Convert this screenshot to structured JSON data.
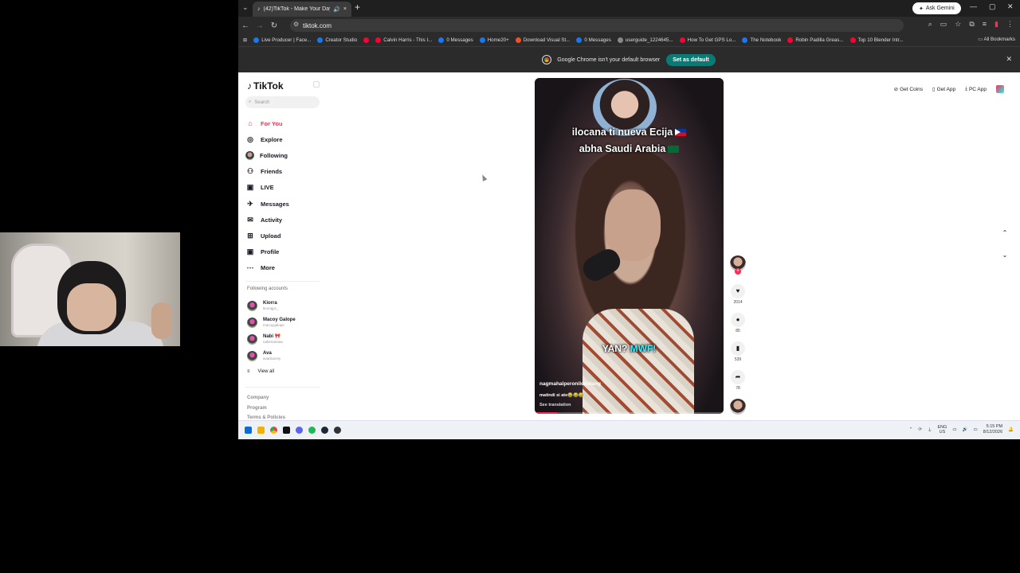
{
  "browser": {
    "tab_title": "(42)TikTok - Make Your Day",
    "tab_close": "×",
    "new_tab": "+",
    "ask_gemini": "Ask Gemini",
    "url": "tiktok.com"
  },
  "bookmarks": [
    {
      "label": "Live Producer | Face...",
      "color": "#1877f2"
    },
    {
      "label": "Creator Studio",
      "color": "#1877f2"
    },
    {
      "label": "",
      "color": "#ff0033"
    },
    {
      "label": "Calvin Harris - This I...",
      "color": "#ff0033"
    },
    {
      "label": "0 Messages",
      "color": "#1877f2"
    },
    {
      "label": "Home20+",
      "color": "#1877f2"
    },
    {
      "label": "Download Visual St...",
      "color": "#f25022"
    },
    {
      "label": "0 Messages",
      "color": "#1877f2"
    },
    {
      "label": "userguide_1224645...",
      "color": "#888888"
    },
    {
      "label": "How To Get GPS Lo...",
      "color": "#ff0033"
    },
    {
      "label": "The Notebook",
      "color": "#1877f2"
    },
    {
      "label": "Robin Padilla Greas...",
      "color": "#ff0033"
    },
    {
      "label": "Top 10 Blender Intr...",
      "color": "#ff0033"
    }
  ],
  "all_bookmarks": "All Bookmarks",
  "infobar": {
    "message": "Google Chrome isn't your default browser",
    "button": "Set as default"
  },
  "tiktok": {
    "logo": "TikTok",
    "search_placeholder": "Search",
    "nav": [
      {
        "label": "For You",
        "icon": "home-icon",
        "glyph": "⌂",
        "active": true
      },
      {
        "label": "Explore",
        "icon": "compass-icon",
        "glyph": "◎",
        "active": false
      },
      {
        "label": "Following",
        "icon": "avatar-icon",
        "glyph": "",
        "active": false
      },
      {
        "label": "Friends",
        "icon": "friends-icon",
        "glyph": "⚇",
        "active": false
      },
      {
        "label": "LIVE",
        "icon": "live-icon",
        "glyph": "▣",
        "active": false
      },
      {
        "label": "Messages",
        "icon": "messages-icon",
        "glyph": "✈",
        "active": false
      },
      {
        "label": "Activity",
        "icon": "activity-icon",
        "glyph": "✉",
        "active": false
      },
      {
        "label": "Upload",
        "icon": "upload-icon",
        "glyph": "⊞",
        "active": false
      },
      {
        "label": "Profile",
        "icon": "profile-icon",
        "glyph": "▣",
        "active": false
      },
      {
        "label": "More",
        "icon": "more-icon",
        "glyph": "⋯",
        "active": false
      }
    ],
    "following_title": "Following accounts",
    "following": [
      {
        "name": "Kiorra",
        "handle": "kiorrajpc_"
      },
      {
        "name": "Macoy Galope",
        "handle": "macoygalope"
      },
      {
        "name": "Nabi 🎀",
        "handle": "nabimariaaa"
      },
      {
        "name": "Ava",
        "handle": "avadcarrey"
      }
    ],
    "view_all": "View all",
    "footer": [
      "Company",
      "Program",
      "Terms & Policies"
    ],
    "top_right": {
      "get_coins": "Get Coins",
      "get_app": "Get App",
      "pc_app": "PC App"
    }
  },
  "video": {
    "caption_line1": "ilocana ti nueva Ecija",
    "caption_line2": "abha Saudi Arabia",
    "overlay_text_a": "YAN?",
    "overlay_text_b": "MWF!",
    "username": "nagmahalperonilokolang",
    "description": "matindi si ate😂😂😂",
    "see_translation": "See translation",
    "progress": 0.12
  },
  "actions": {
    "likes": "2014",
    "comments": "85",
    "saves": "539",
    "shares": "78"
  },
  "tray": {
    "lang": "ENG",
    "region": "US",
    "time": "5:15 PM",
    "date": "8/12/2026"
  }
}
